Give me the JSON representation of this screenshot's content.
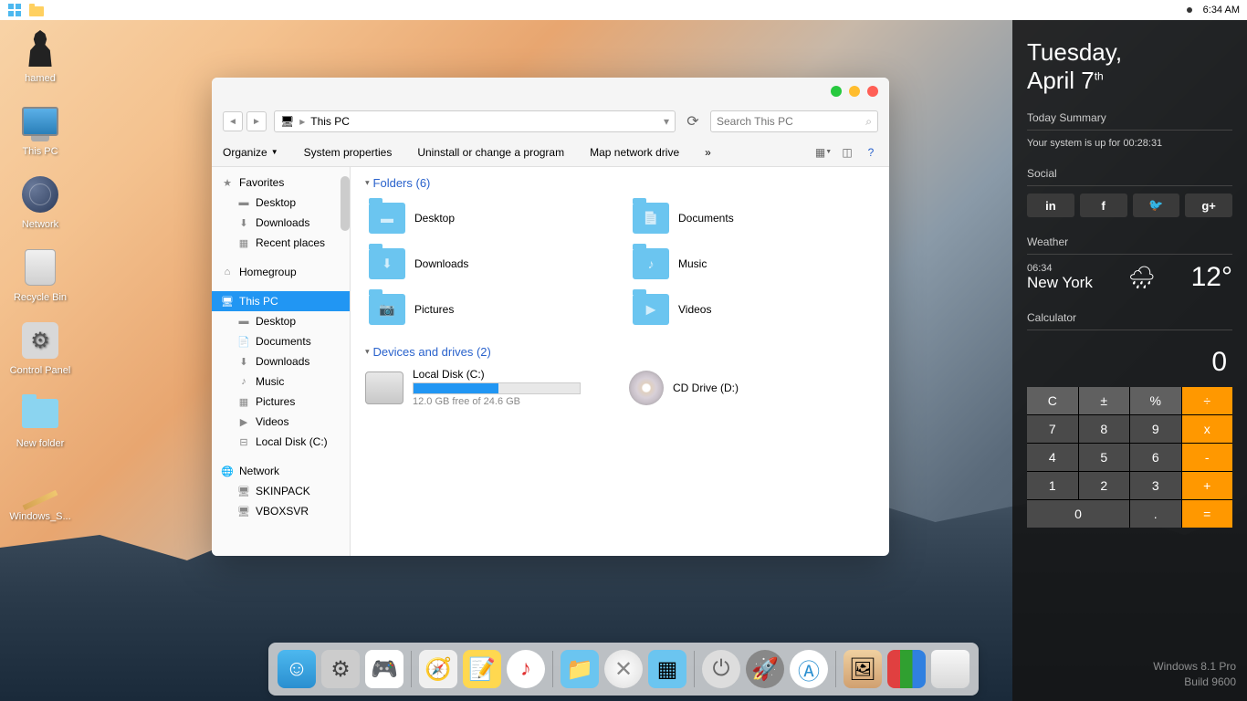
{
  "taskbar": {
    "time": "6:34 AM"
  },
  "desktop": {
    "icons": [
      {
        "label": "hamed"
      },
      {
        "label": "This PC"
      },
      {
        "label": "Network"
      },
      {
        "label": "Recycle Bin"
      },
      {
        "label": "Control Panel"
      },
      {
        "label": "New folder"
      },
      {
        "label": "Windows_S..."
      }
    ]
  },
  "explorer": {
    "address": "This PC",
    "search_placeholder": "Search This PC",
    "toolbar": {
      "organize": "Organize",
      "system_props": "System properties",
      "uninstall": "Uninstall or change a program",
      "map_drive": "Map network drive",
      "more": "»"
    },
    "sidebar": {
      "favorites": {
        "label": "Favorites",
        "items": [
          "Desktop",
          "Downloads",
          "Recent places"
        ]
      },
      "homegroup": {
        "label": "Homegroup"
      },
      "thispc": {
        "label": "This PC",
        "items": [
          "Desktop",
          "Documents",
          "Downloads",
          "Music",
          "Pictures",
          "Videos",
          "Local Disk (C:)"
        ]
      },
      "network": {
        "label": "Network",
        "items": [
          "SKINPACK",
          "VBOXSVR"
        ]
      }
    },
    "sections": {
      "folders": {
        "title": "Folders (6)",
        "items": [
          "Desktop",
          "Documents",
          "Downloads",
          "Music",
          "Pictures",
          "Videos"
        ]
      },
      "devices": {
        "title": "Devices and drives (2)",
        "drives": [
          {
            "name": "Local Disk (C:)",
            "free_text": "12.0 GB free of 24.6 GB",
            "fill_pct": 51
          },
          {
            "name": "CD Drive (D:)"
          }
        ]
      }
    }
  },
  "panel": {
    "date_day": "Tuesday,",
    "date_month": "April 7",
    "date_suffix": "th",
    "summary_title": "Today Summary",
    "uptime": "Your system is up for 00:28:31",
    "social_title": "Social",
    "weather": {
      "title": "Weather",
      "time": "06:34",
      "city": "New York",
      "temp": "12°"
    },
    "calculator": {
      "title": "Calculator",
      "display": "0",
      "rows": [
        [
          "C",
          "±",
          "%",
          "÷"
        ],
        [
          "7",
          "8",
          "9",
          "x"
        ],
        [
          "4",
          "5",
          "6",
          "-"
        ],
        [
          "1",
          "2",
          "3",
          "+"
        ],
        [
          "0",
          ".",
          "="
        ]
      ]
    }
  },
  "watermark": {
    "line1": "Windows 8.1 Pro",
    "line2": "Build 9600"
  }
}
